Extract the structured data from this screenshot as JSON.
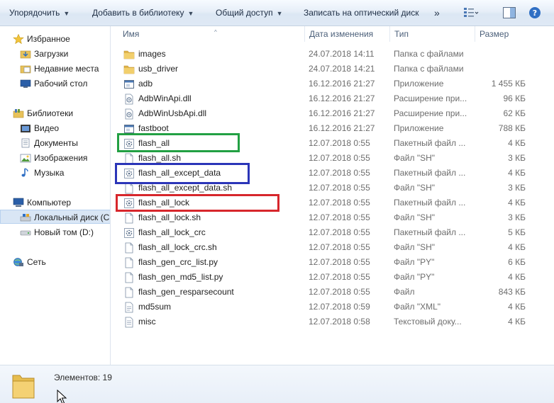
{
  "toolbar": {
    "organize": "Упорядочить",
    "add_to_library": "Добавить в библиотеку",
    "share": "Общий доступ",
    "burn": "Записать на оптический диск",
    "more": "»"
  },
  "nav": {
    "favorites": "Избранное",
    "downloads": "Загрузки",
    "recent_places": "Недавние места",
    "desktop": "Рабочий стол",
    "libraries": "Библиотеки",
    "video": "Видео",
    "documents": "Документы",
    "pictures": "Изображения",
    "music": "Музыка",
    "computer": "Компьютер",
    "local_disk": "Локальный диск (C",
    "new_volume": "Новый том (D:)",
    "network": "Сеть"
  },
  "columns": {
    "name": "Имя",
    "date": "Дата изменения",
    "type": "Тип",
    "size": "Размер"
  },
  "files": [
    {
      "name": "images",
      "date": "24.07.2018 14:11",
      "type": "Папка с файлами",
      "size": "",
      "icon": "folder-icon"
    },
    {
      "name": "usb_driver",
      "date": "24.07.2018 14:21",
      "type": "Папка с файлами",
      "size": "",
      "icon": "folder-icon"
    },
    {
      "name": "adb",
      "date": "16.12.2016 21:27",
      "type": "Приложение",
      "size": "1 455 КБ",
      "icon": "app-icon"
    },
    {
      "name": "AdbWinApi.dll",
      "date": "16.12.2016 21:27",
      "type": "Расширение при...",
      "size": "96 КБ",
      "icon": "dll-icon"
    },
    {
      "name": "AdbWinUsbApi.dll",
      "date": "16.12.2016 21:27",
      "type": "Расширение при...",
      "size": "62 КБ",
      "icon": "dll-icon"
    },
    {
      "name": "fastboot",
      "date": "16.12.2016 21:27",
      "type": "Приложение",
      "size": "788 КБ",
      "icon": "app-icon"
    },
    {
      "name": "flash_all",
      "date": "12.07.2018 0:55",
      "type": "Пакетный файл ...",
      "size": "4 КБ",
      "icon": "batch-icon"
    },
    {
      "name": "flash_all.sh",
      "date": "12.07.2018 0:55",
      "type": "Файл \"SH\"",
      "size": "3 КБ",
      "icon": "file-icon"
    },
    {
      "name": "flash_all_except_data",
      "date": "12.07.2018 0:55",
      "type": "Пакетный файл ...",
      "size": "4 КБ",
      "icon": "batch-icon"
    },
    {
      "name": "flash_all_except_data.sh",
      "date": "12.07.2018 0:55",
      "type": "Файл \"SH\"",
      "size": "3 КБ",
      "icon": "file-icon"
    },
    {
      "name": "flash_all_lock",
      "date": "12.07.2018 0:55",
      "type": "Пакетный файл ...",
      "size": "4 КБ",
      "icon": "batch-icon"
    },
    {
      "name": "flash_all_lock.sh",
      "date": "12.07.2018 0:55",
      "type": "Файл \"SH\"",
      "size": "3 КБ",
      "icon": "file-icon"
    },
    {
      "name": "flash_all_lock_crc",
      "date": "12.07.2018 0:55",
      "type": "Пакетный файл ...",
      "size": "5 КБ",
      "icon": "batch-icon"
    },
    {
      "name": "flash_all_lock_crc.sh",
      "date": "12.07.2018 0:55",
      "type": "Файл \"SH\"",
      "size": "4 КБ",
      "icon": "file-icon"
    },
    {
      "name": "flash_gen_crc_list.py",
      "date": "12.07.2018 0:55",
      "type": "Файл \"PY\"",
      "size": "6 КБ",
      "icon": "file-icon"
    },
    {
      "name": "flash_gen_md5_list.py",
      "date": "12.07.2018 0:55",
      "type": "Файл \"PY\"",
      "size": "4 КБ",
      "icon": "file-icon"
    },
    {
      "name": "flash_gen_resparsecount",
      "date": "12.07.2018 0:55",
      "type": "Файл",
      "size": "843 КБ",
      "icon": "file-icon"
    },
    {
      "name": "md5sum",
      "date": "12.07.2018 0:59",
      "type": "Файл \"XML\"",
      "size": "4 КБ",
      "icon": "xml-icon"
    },
    {
      "name": "misc",
      "date": "12.07.2018 0:58",
      "type": "Текстовый доку...",
      "size": "4 КБ",
      "icon": "text-icon"
    }
  ],
  "status": {
    "count": "Элементов: 19"
  },
  "colors": {
    "highlight_green": "#22a043",
    "highlight_blue": "#2b35b8",
    "highlight_red": "#d7262c"
  }
}
